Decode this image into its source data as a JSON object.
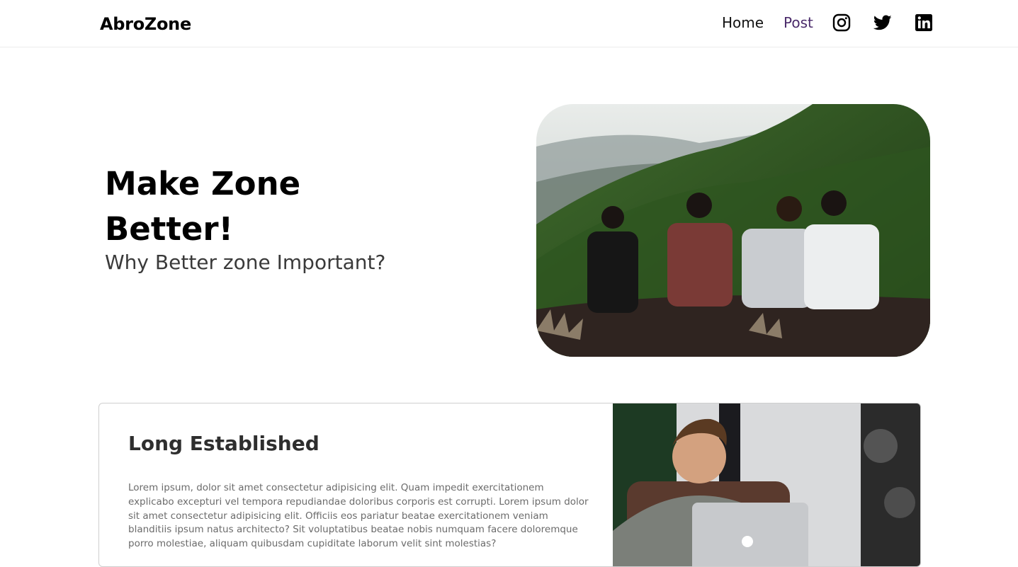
{
  "navbar": {
    "brand": "AbroZone",
    "links": [
      {
        "label": "Home"
      },
      {
        "label": "Post"
      }
    ],
    "social_icons": [
      "instagram-icon",
      "twitter-icon",
      "linkedin-icon"
    ]
  },
  "hero": {
    "title": "Make Zone Better!",
    "subtitle": "Why Better zone Important?",
    "image": "four-friends-on-hill-photo"
  },
  "feature_card": {
    "title": "Long Established",
    "text": "Lorem ipsum, dolor sit amet consectetur adipisicing elit. Quam impedit exercitationem explicabo excepturi vel tempora repudiandae doloribus corporis est corrupti. Lorem ipsum dolor sit amet consectetur adipisicing elit. Officiis eos pariatur beatae exercitationem veniam blanditiis ipsum natus architecto? Sit voluptatibus beatae nobis numquam facere doloremque porro molestiae, aliquam quibusdam cupiditate laborum velit sint molestias?",
    "image": "man-with-laptop-photo"
  },
  "colors": {
    "post_link": "#4a2a6a",
    "card_text": "#6b6b6b",
    "border": "#cfcfcf"
  }
}
